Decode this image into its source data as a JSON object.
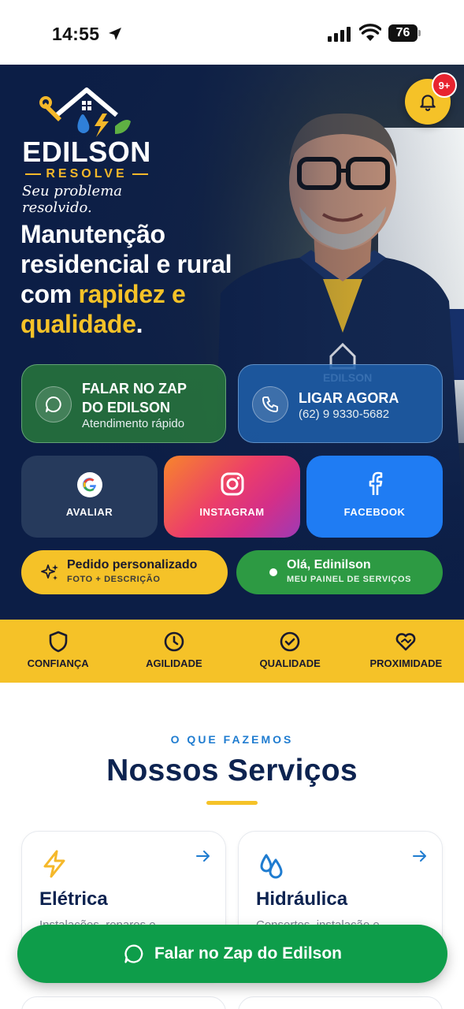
{
  "status_bar": {
    "time": "14:55",
    "battery": "76"
  },
  "brand": {
    "name": "EDILSON",
    "sub": "RESOLVE",
    "tagline": "Seu problema resolvido."
  },
  "notifications": {
    "badge": "9+"
  },
  "hero": {
    "headline_line1": "Manutenção",
    "headline_line2": "residencial e rural",
    "headline_line3_plain": "com ",
    "headline_line3_highlight": "rapidez e",
    "headline_line4_highlight": "qualidade",
    "headline_line4_end": "."
  },
  "actions": {
    "zap": {
      "title_line1": "FALAR NO ZAP",
      "title_line2": "DO EDILSON",
      "subtitle": "Atendimento rápido"
    },
    "call": {
      "title": "LIGAR AGORA",
      "phone": "(62) 9 9330-5682"
    }
  },
  "social": {
    "google": "AVALIAR",
    "instagram": "INSTAGRAM",
    "facebook": "FACEBOOK"
  },
  "pills": {
    "order": {
      "title": "Pedido personalizado",
      "subtitle": "FOTO + DESCRIÇÃO"
    },
    "panel": {
      "title": "Olá, Edinilson",
      "subtitle": "MEU PAINEL DE SERVIÇOS"
    }
  },
  "values": [
    {
      "label": "CONFIANÇA",
      "icon": "shield-icon"
    },
    {
      "label": "AGILIDADE",
      "icon": "clock-icon"
    },
    {
      "label": "QUALIDADE",
      "icon": "check-circle-icon"
    },
    {
      "label": "PROXIMIDADE",
      "icon": "heart-handshake-icon"
    }
  ],
  "services": {
    "eyebrow": "O QUE FAZEMOS",
    "title": "Nossos Serviços",
    "items": [
      {
        "title": "Elétrica",
        "desc": "Instalações, reparos e",
        "icon": "lightning-icon"
      },
      {
        "title": "Hidráulica",
        "desc": "Consertos, instalação e",
        "icon": "water-drops-icon"
      }
    ]
  },
  "cta": {
    "label": "Falar no Zap do Edilson"
  },
  "colors": {
    "navy": "#0c1e44",
    "yellow": "#f5c228",
    "green": "#0e9d4a",
    "blue": "#1f7cf3"
  }
}
